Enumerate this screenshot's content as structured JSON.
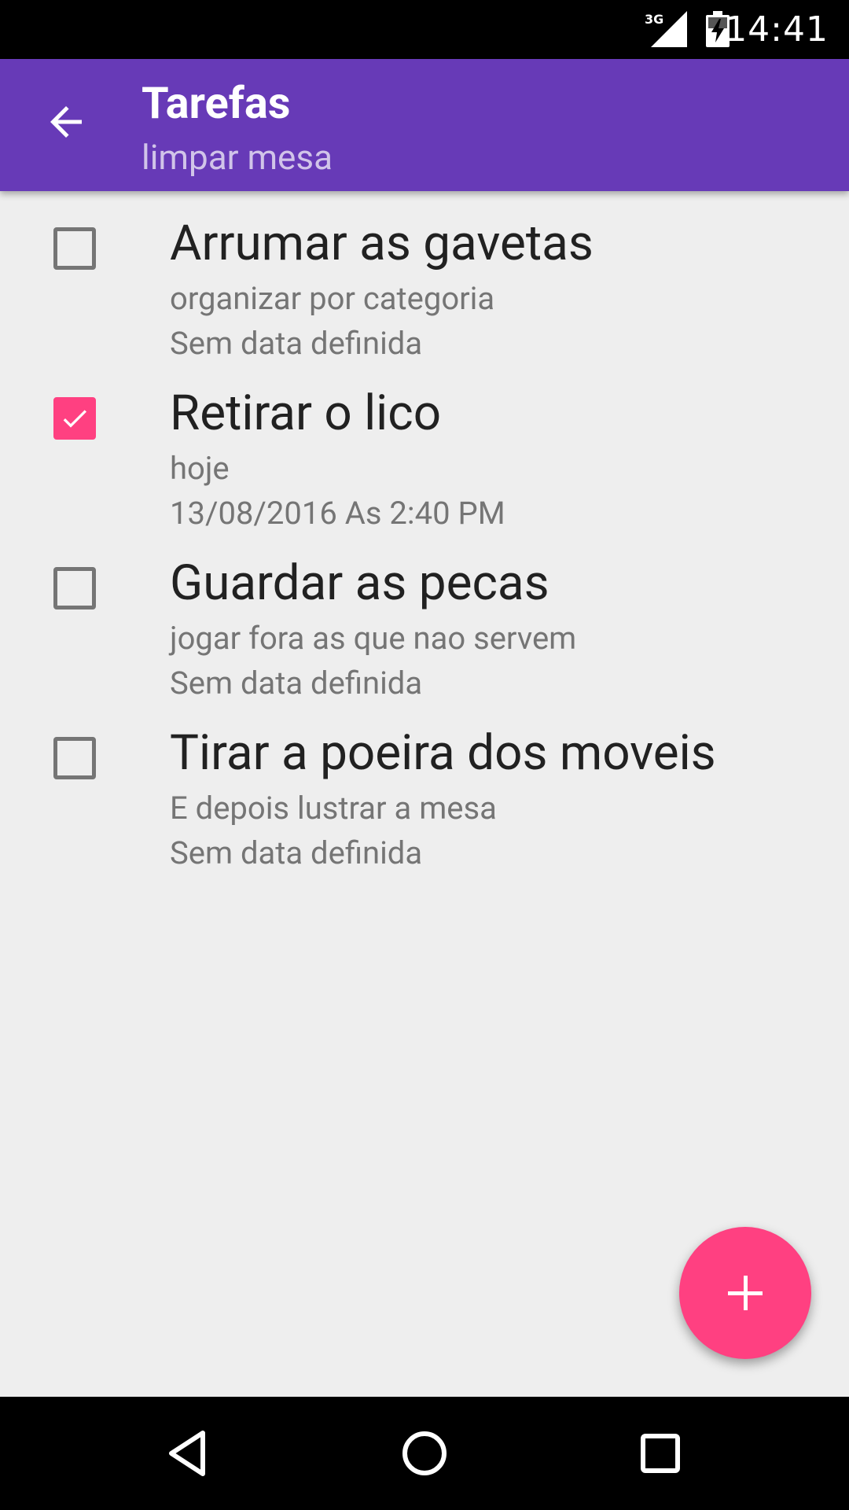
{
  "status_bar": {
    "network": "3G",
    "time": "14:41"
  },
  "app_bar": {
    "title": "Tarefas",
    "subtitle": "limpar mesa"
  },
  "tasks": [
    {
      "title": "Arrumar as gavetas",
      "description": "organizar por categoria",
      "date": "Sem data definida",
      "checked": false
    },
    {
      "title": "Retirar o lico",
      "description": "hoje",
      "date": "13/08/2016 As 2:40 PM",
      "checked": true
    },
    {
      "title": "Guardar as pecas",
      "description": "jogar fora as que nao servem",
      "date": "Sem data definida",
      "checked": false
    },
    {
      "title": "Tirar a poeira dos moveis",
      "description": "E depois lustrar a mesa",
      "date": "Sem data definida",
      "checked": false
    }
  ],
  "icons": {
    "back": "arrow-back-icon",
    "add": "add-icon",
    "nav_back": "nav-back-icon",
    "nav_home": "nav-home-icon",
    "nav_recents": "nav-recents-icon"
  },
  "colors": {
    "primary": "#673ab7",
    "subtitle": "#d1c4e9",
    "accent": "#ff4081",
    "background": "#eeeeee"
  }
}
